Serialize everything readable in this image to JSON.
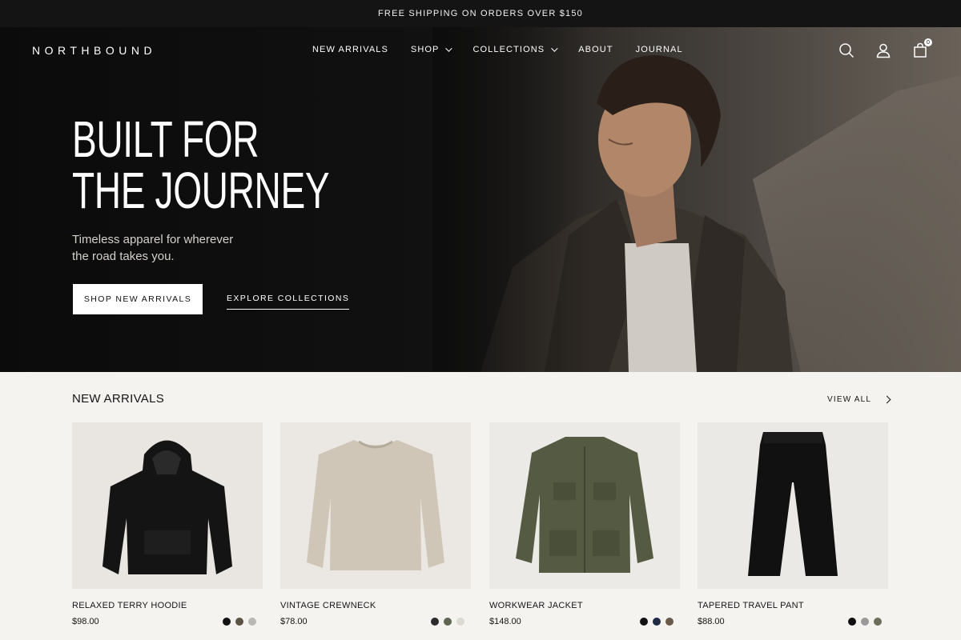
{
  "announcement": "FREE SHIPPING ON ORDERS OVER $150",
  "brand": "NORTHBOUND",
  "nav": [
    {
      "label": "NEW ARRIVALS"
    },
    {
      "label": "SHOP"
    },
    {
      "label": "COLLECTIONS"
    },
    {
      "label": "ABOUT"
    },
    {
      "label": "JOURNAL"
    }
  ],
  "header_icons": {
    "search": "search-icon",
    "account": "user-icon",
    "cart": "bag-icon",
    "cart_count": "0"
  },
  "hero": {
    "headline_line1": "BUILT FOR",
    "headline_line2": "THE JOURNEY",
    "subhead_line1": "Timeless apparel for wherever",
    "subhead_line2": "the road takes you.",
    "primary_cta": "SHOP NEW ARRIVALS",
    "secondary_cta": "EXPLORE COLLECTIONS"
  },
  "new_arrivals": {
    "title": "NEW ARRIVALS",
    "view_all": "VIEW ALL",
    "products": [
      {
        "name": "RELAXED TERRY HOODIE",
        "price": "$98.00",
        "swatches": [
          "#111111",
          "#5e5244",
          "#b9b7b4"
        ]
      },
      {
        "name": "VINTAGE CREWNECK",
        "price": "$78.00",
        "swatches": [
          "#2b2b2b",
          "#5f6650",
          "#dcd8d2"
        ]
      },
      {
        "name": "WORKWEAR JACKET",
        "price": "$148.00",
        "swatches": [
          "#111111",
          "#1f2a44",
          "#6b5a48"
        ]
      },
      {
        "name": "TAPERED TRAVEL PANT",
        "price": "$88.00",
        "swatches": [
          "#0f0f0f",
          "#9a9a9a",
          "#6b6e58"
        ]
      }
    ]
  },
  "colors": {
    "announcement_bg": "#141414",
    "page_bg": "#f5f3f0",
    "accent": "#ffffff"
  }
}
